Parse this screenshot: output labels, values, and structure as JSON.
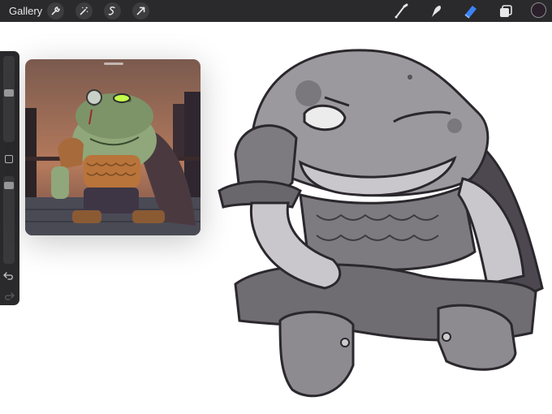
{
  "toolbar": {
    "gallery_label": "Gallery",
    "left_tools": [
      "wrench-icon",
      "magic-wand-icon",
      "selection-icon",
      "transform-arrow-icon"
    ],
    "right_tools": [
      "brush-icon",
      "smudge-icon",
      "eraser-icon",
      "layers-icon"
    ],
    "active_tool": "eraser",
    "accent_color": "#3b82f6",
    "current_color": "#2a1f2b"
  },
  "sidebar": {
    "brush_size": 0.27,
    "opacity": 0.94
  },
  "reference_window": {
    "kind": "reference image"
  }
}
